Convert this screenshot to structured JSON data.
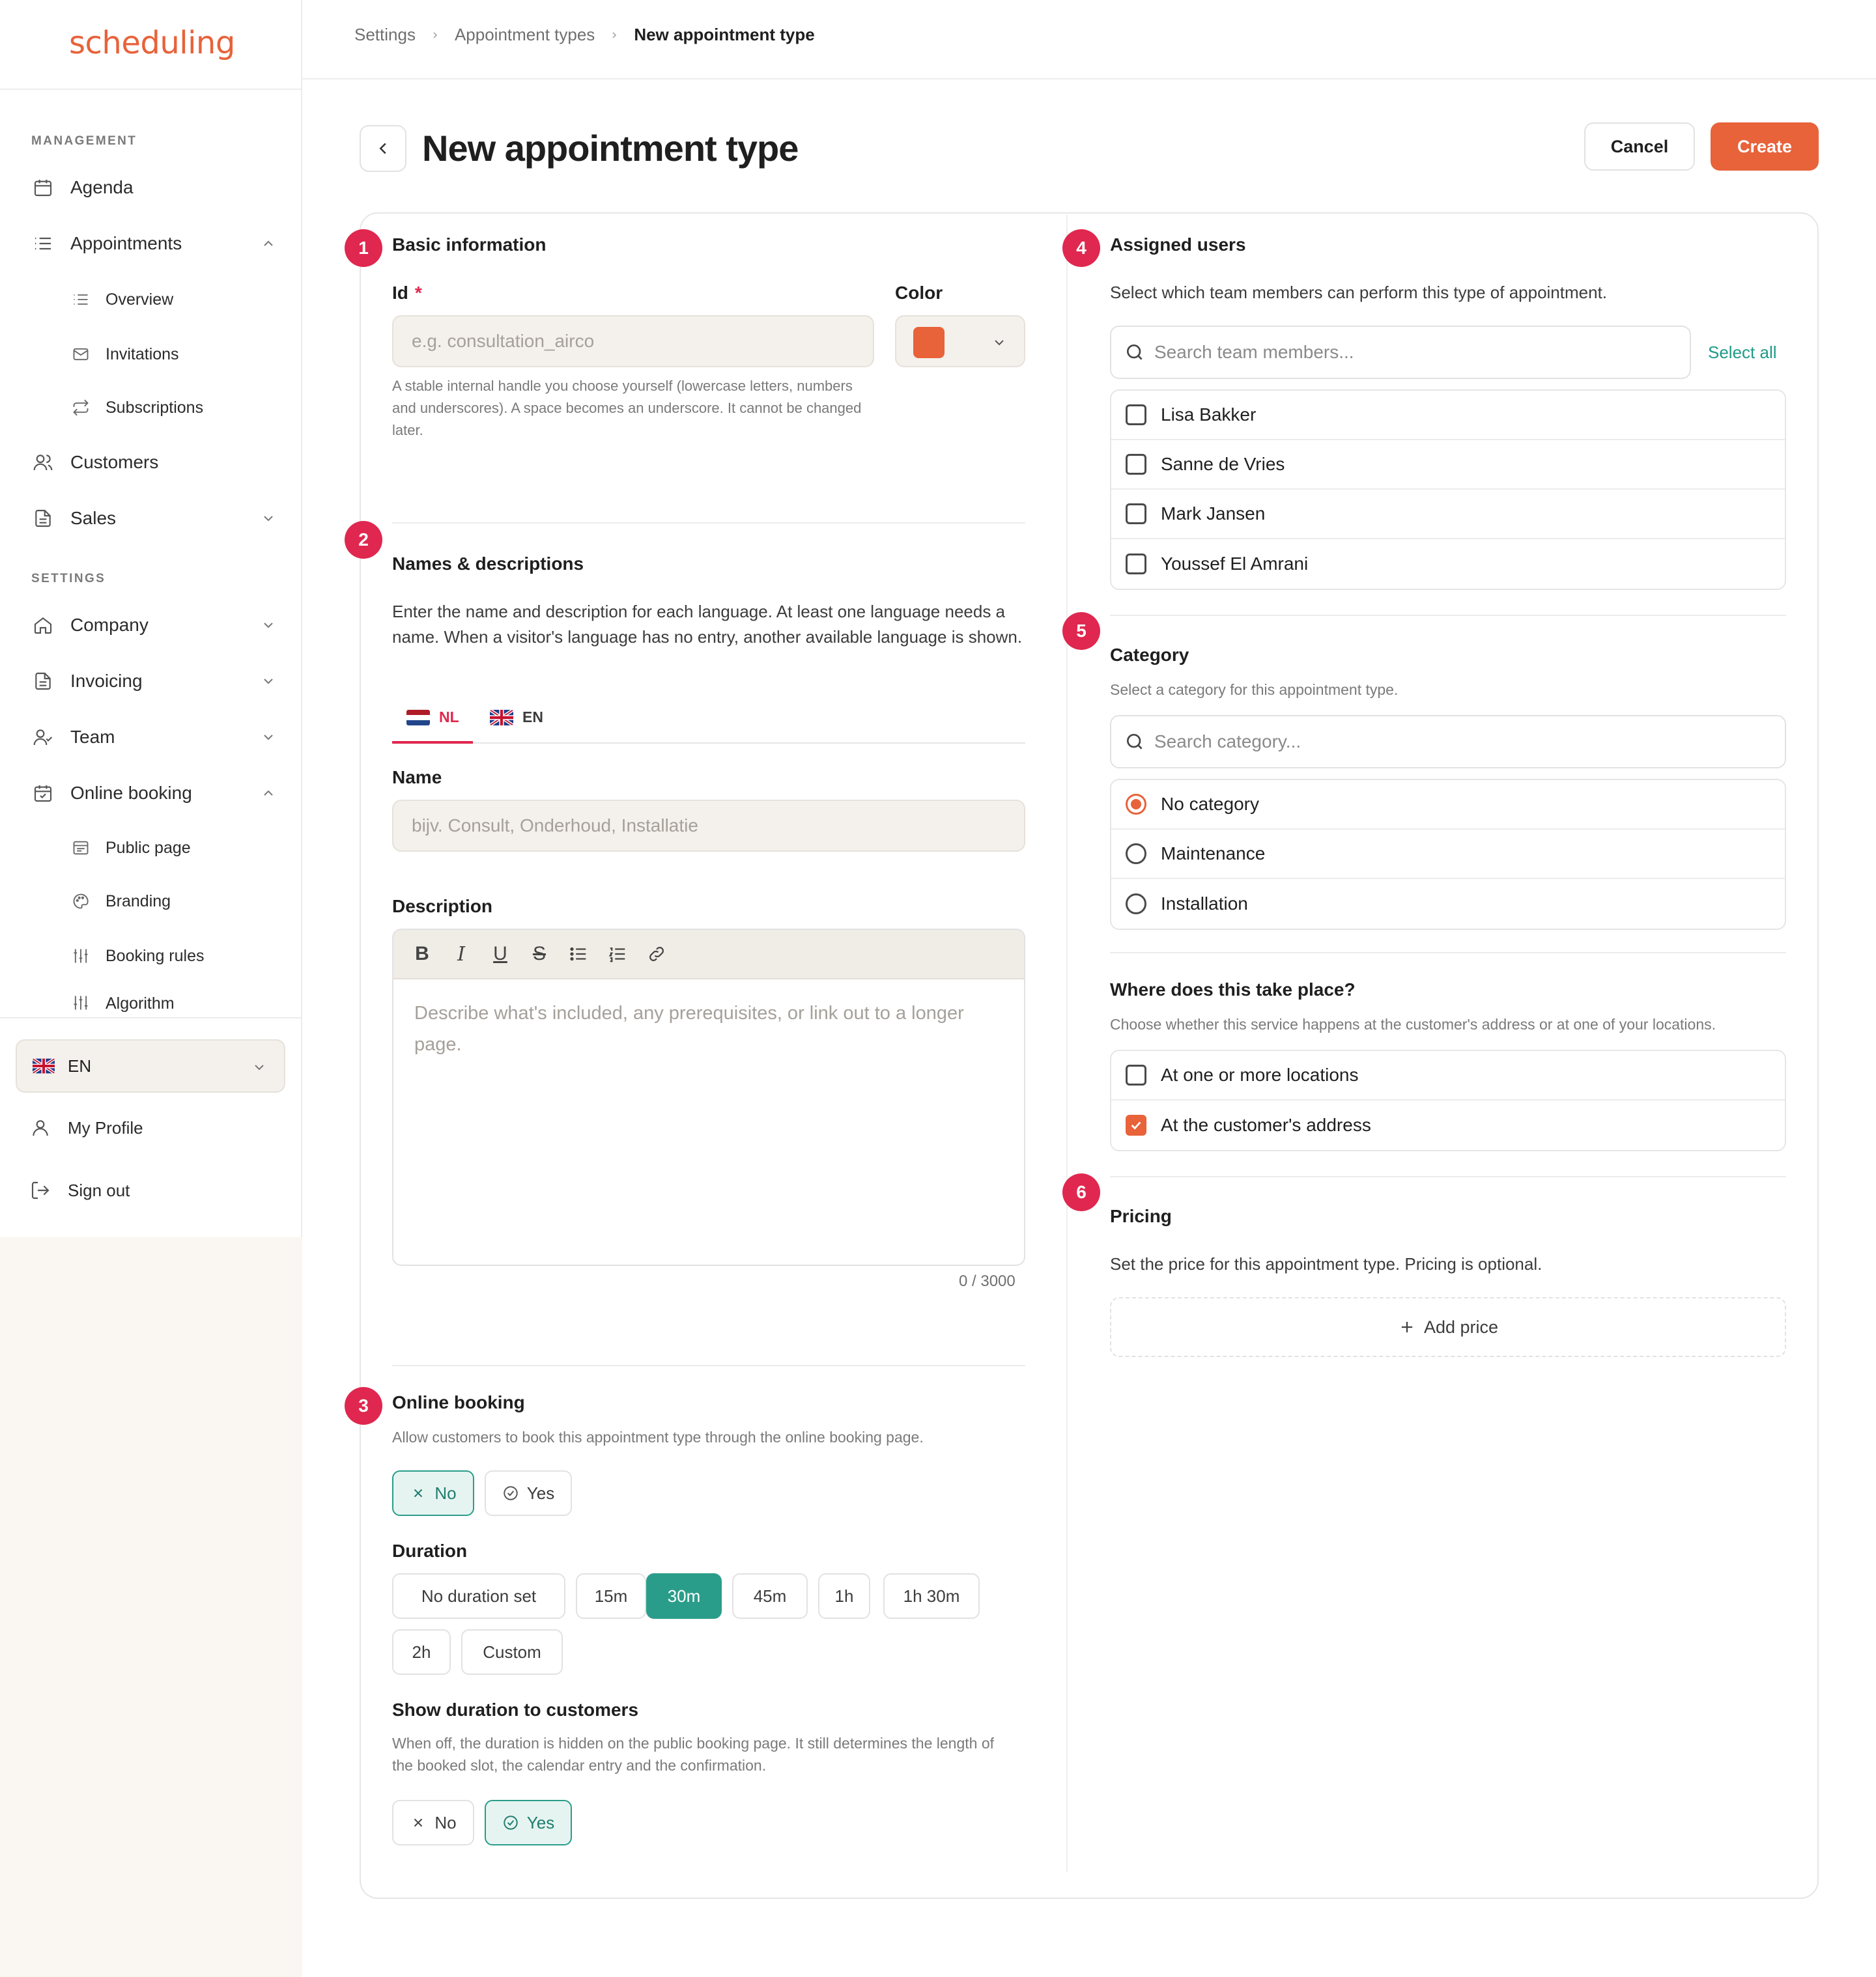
{
  "app": {
    "logo": "scheduling"
  },
  "sidebar": {
    "management_label": "MANAGEMENT",
    "settings_label": "SETTINGS",
    "items": {
      "agenda": "Agenda",
      "appointments": "Appointments",
      "overview": "Overview",
      "invitations": "Invitations",
      "subscriptions": "Subscriptions",
      "customers": "Customers",
      "sales": "Sales",
      "company": "Company",
      "invoicing": "Invoicing",
      "team": "Team",
      "online_booking": "Online booking",
      "public_page": "Public page",
      "branding": "Branding",
      "booking_rules": "Booking rules",
      "algorithm": "Algorithm"
    },
    "language": "EN",
    "my_profile": "My Profile",
    "sign_out": "Sign out"
  },
  "breadcrumb": [
    "Settings",
    "Appointment types",
    "New appointment type"
  ],
  "header": {
    "title": "New appointment type",
    "cancel": "Cancel",
    "create": "Create"
  },
  "colors": {
    "accent": "#e8623a",
    "step": "#e0274f",
    "teal": "#2a9d8a"
  },
  "basic": {
    "step": "1",
    "title": "Basic information",
    "id_label": "Id",
    "required_mark": "*",
    "id_placeholder": "e.g. consultation_airco",
    "id_help": "A stable internal handle you choose yourself (lowercase letters, numbers and underscores). A space becomes an underscore. It cannot be changed later.",
    "color_label": "Color",
    "color_value": "#e8623a"
  },
  "names": {
    "step": "2",
    "title": "Names & descriptions",
    "intro": "Enter the name and description for each language. At least one language needs a name. When a visitor's language has no entry, another available language is shown.",
    "tabs": [
      "NL",
      "EN"
    ],
    "name_label": "Name",
    "name_placeholder": "bijv. Consult, Onderhoud, Installatie",
    "description_label": "Description",
    "description_placeholder": "Describe what's included, any prerequisites, or link out to a longer page.",
    "counter": "0 / 3000"
  },
  "online": {
    "step": "3",
    "title": "Online booking",
    "help": "Allow customers to book this appointment type through the online booking page.",
    "no": "No",
    "yes": "Yes",
    "duration_label": "Duration",
    "durations": [
      "No duration set",
      "15m",
      "30m",
      "45m",
      "1h",
      "1h 30m",
      "2h",
      "Custom"
    ],
    "show_duration_label": "Show duration to customers",
    "show_duration_help": "When off, the duration is hidden on the public booking page. It still determines the length of the booked slot, the calendar entry and the confirmation.",
    "show_no": "No",
    "show_yes": "Yes"
  },
  "assigned": {
    "step": "4",
    "title": "Assigned users",
    "help": "Select which team members can perform this type of appointment.",
    "search_placeholder": "Search team members...",
    "select_all": "Select all",
    "users": [
      "Lisa Bakker",
      "Sanne de Vries",
      "Mark Jansen",
      "Youssef El Amrani"
    ]
  },
  "category": {
    "step": "5",
    "title": "Category",
    "help": "Select a category for this appointment type.",
    "search_placeholder": "Search category...",
    "options": [
      "No category",
      "Maintenance",
      "Installation"
    ],
    "selected": "No category"
  },
  "location": {
    "title": "Where does this take place?",
    "help": "Choose whether this service happens at the customer's address or at one of your locations.",
    "options": [
      "At one or more locations",
      "At the customer's address"
    ]
  },
  "pricing": {
    "step": "6",
    "title": "Pricing",
    "help": "Set the price for this appointment type. Pricing is optional.",
    "add_price": "Add price"
  }
}
